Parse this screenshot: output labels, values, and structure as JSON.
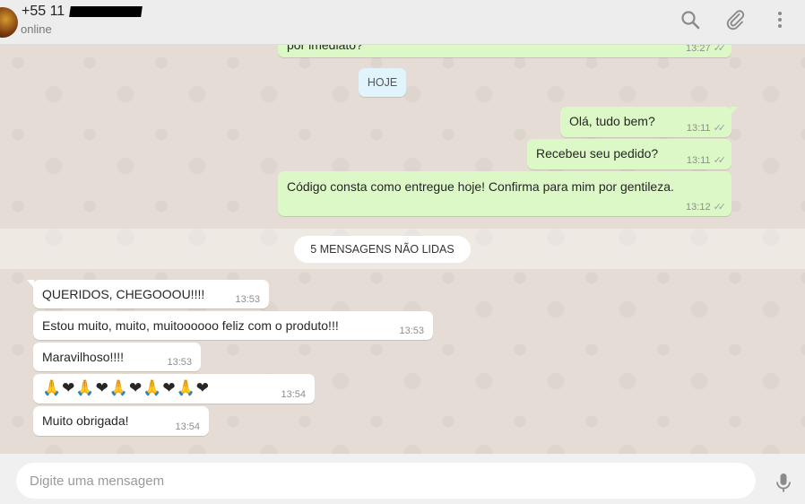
{
  "header": {
    "contact_name": "+55 11",
    "status": "online",
    "icons": [
      "search-icon",
      "paperclip-icon",
      "menu-dots-icon"
    ]
  },
  "chat": {
    "prev_message": {
      "text": "por imediato?",
      "time": "13:27"
    },
    "date_divider": "HOJE",
    "outgoing": [
      {
        "text": "Olá, tudo bem?",
        "time": "13:11"
      },
      {
        "text": "Recebeu seu pedido?",
        "time": "13:11"
      },
      {
        "text": "Código consta como entregue hoje! Confirma para mim por gentileza.",
        "time": "13:12"
      }
    ],
    "unread_divider": "5 MENSAGENS NÃO LIDAS",
    "incoming": [
      {
        "text": "QUERIDOS, CHEGOOOU!!!!",
        "time": "13:53"
      },
      {
        "text": "Estou muito, muito, muitoooooo feliz com o produto!!!",
        "time": "13:53"
      },
      {
        "text": "Maravilhoso!!!!",
        "time": "13:53"
      },
      {
        "text": "🙏❤🙏❤🙏❤🙏❤🙏❤",
        "time": "13:54"
      },
      {
        "text": "Muito obrigada!",
        "time": "13:54"
      }
    ]
  },
  "composer": {
    "placeholder": "Digite uma mensagem"
  },
  "colors": {
    "outgoing_bubble": "#dcf8c6",
    "incoming_bubble": "#ffffff",
    "chat_bg": "#e5ddd5",
    "header_bg": "#ededed"
  }
}
